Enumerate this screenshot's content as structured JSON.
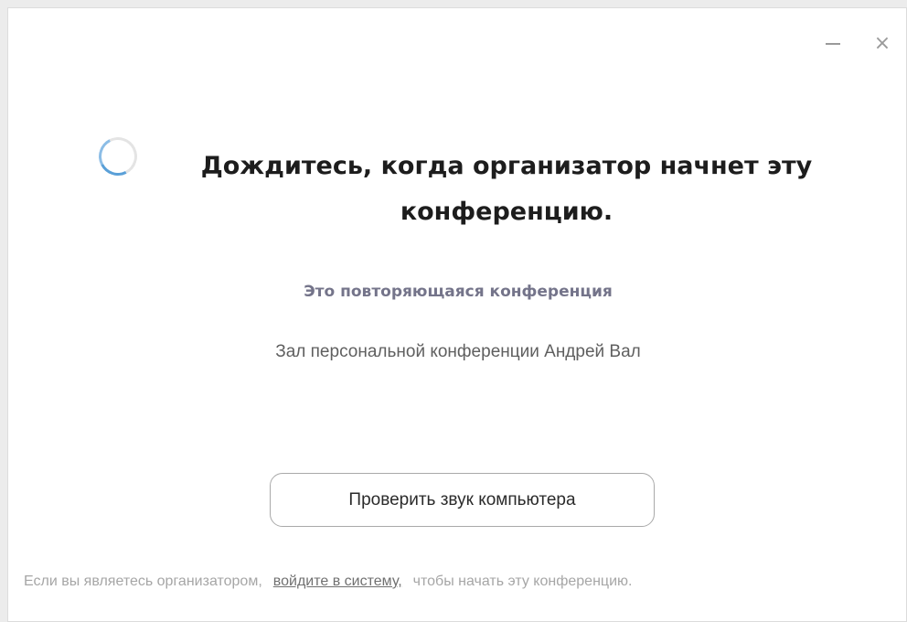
{
  "window": {
    "minimize_icon": "minimize-icon",
    "close_icon": "close-icon",
    "close_glyph": "×"
  },
  "status": {
    "spinner_icon": "loading-spinner-icon",
    "title": "Дождитесь, когда организатор начнет эту конференцию."
  },
  "meeting": {
    "recurring_label": "Это повторяющаяся конференция",
    "room_name": "Зал персональной конференции Андрей Вал"
  },
  "actions": {
    "test_audio_label": "Проверить звук компьютера"
  },
  "footer": {
    "prefix": "Если вы являетесь организатором,",
    "sign_in_link": "войдите в систему,",
    "suffix": "чтобы начать эту конференцию."
  },
  "colors": {
    "spinner_accent": "#5aa0d8",
    "title_text": "#1d1d1d",
    "subtitle_text": "#74748a",
    "footer_text": "#a6a6a6"
  }
}
